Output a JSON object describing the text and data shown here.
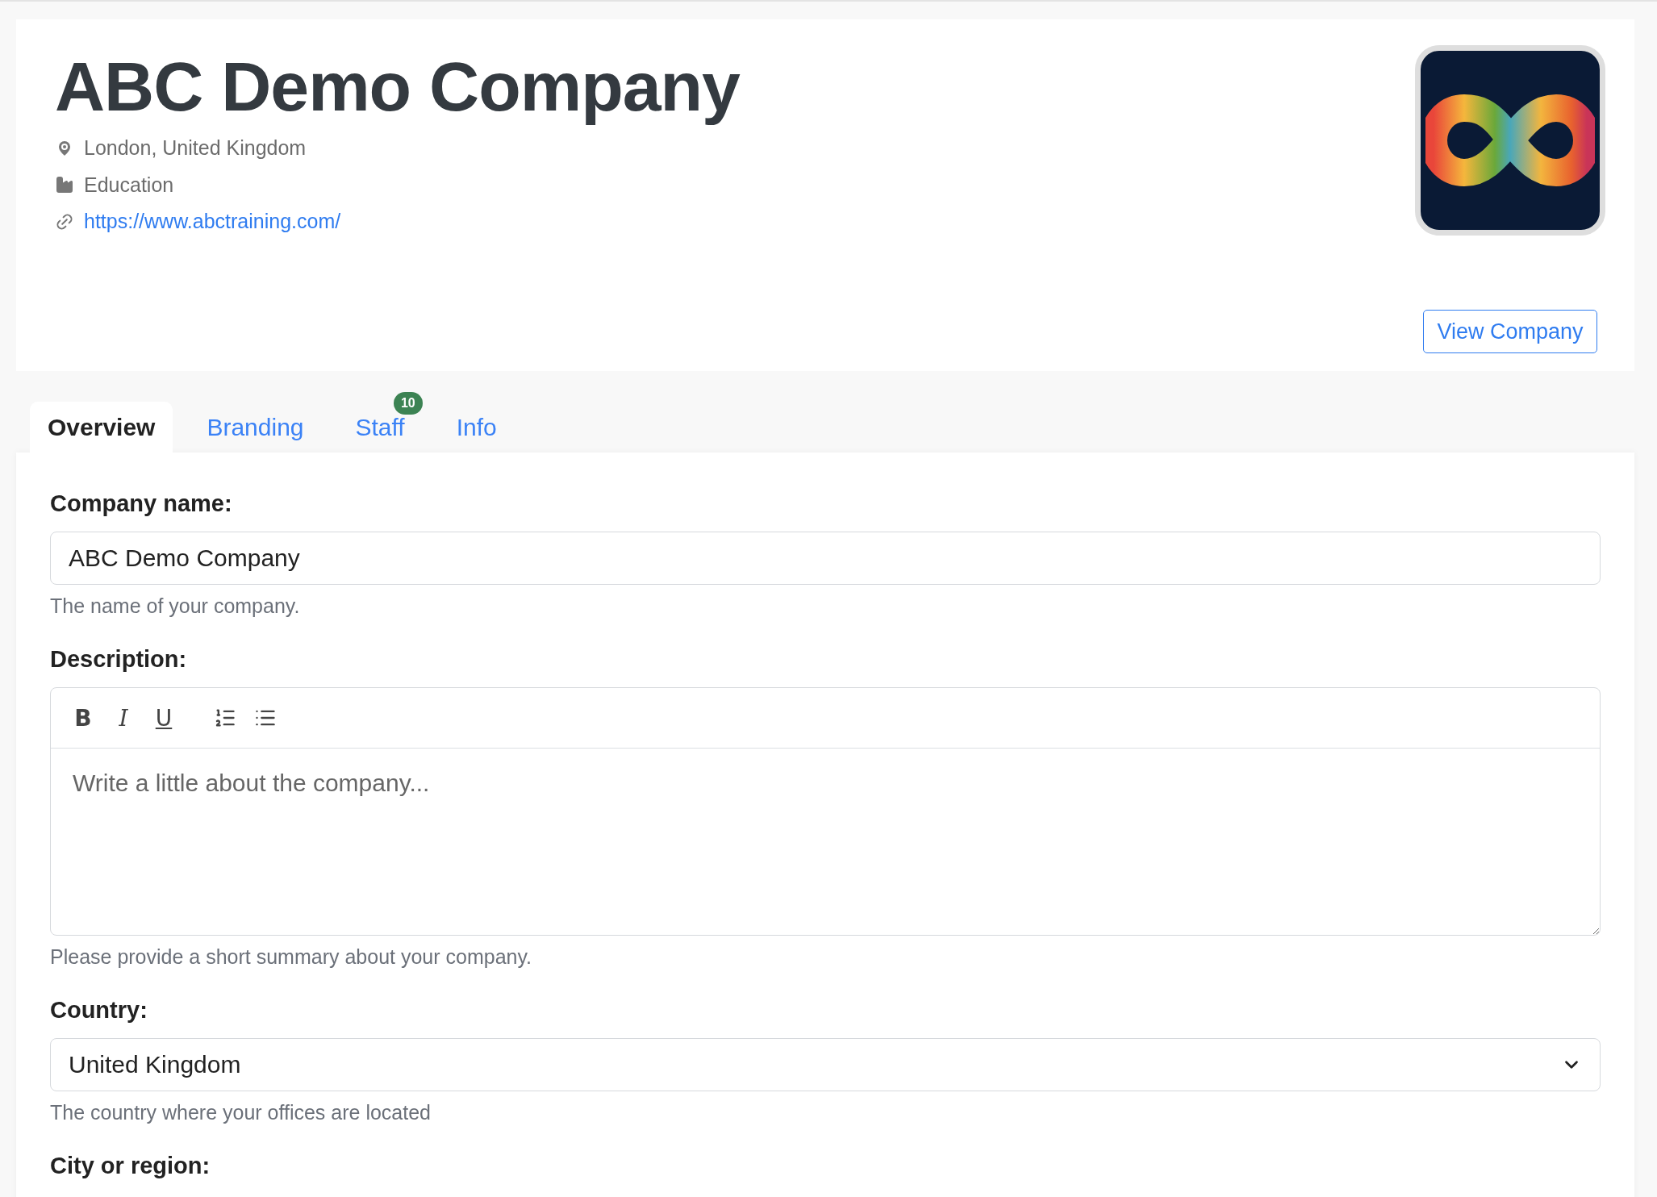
{
  "company": {
    "name": "ABC Demo Company",
    "location": "London, United Kingdom",
    "industry": "Education",
    "website": "https://www.abctraining.com/"
  },
  "view_button": "View Company",
  "tabs": [
    {
      "label": "Overview",
      "selected": true
    },
    {
      "label": "Branding",
      "selected": false
    },
    {
      "label": "Staff",
      "selected": false,
      "badge": "10"
    },
    {
      "label": "Info",
      "selected": false
    }
  ],
  "form": [
    {
      "kind": "text",
      "label": "Company name:",
      "value": "ABC Demo Company",
      "help": "The name of your company."
    },
    {
      "kind": "editor",
      "label": "Description:",
      "placeholder": "Write a little about the company...",
      "help": "Please provide a short summary about your company.",
      "toolbar": [
        {
          "kind": "bold",
          "text": "B"
        },
        {
          "kind": "italic",
          "text": "I"
        },
        {
          "kind": "underline",
          "text": "U"
        },
        {
          "kind": "ordered"
        },
        {
          "kind": "bullets"
        }
      ]
    },
    {
      "kind": "select",
      "label": "Country:",
      "value": "United Kingdom",
      "help": "The country where your offices are located"
    },
    {
      "kind": "text",
      "label": "City or region:"
    }
  ]
}
